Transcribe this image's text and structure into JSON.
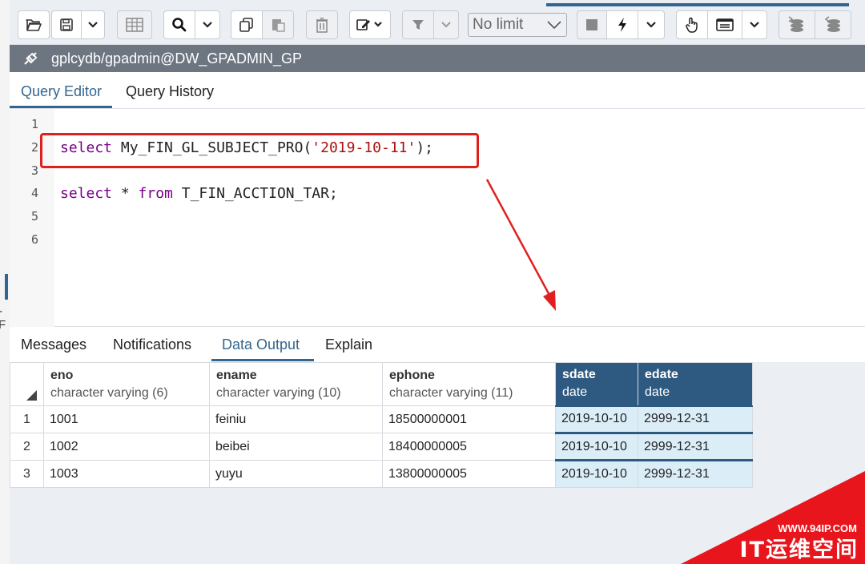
{
  "toolbar": {
    "limit_select": "No limit",
    "buttons": [
      {
        "icon": "open-folder-icon"
      },
      {
        "icon": "save-icon"
      },
      {
        "icon": "chevron-down-icon"
      },
      {
        "icon": "edit-grid-icon"
      },
      {
        "icon": "search-icon"
      },
      {
        "icon": "chevron-down-icon"
      },
      {
        "icon": "copy-icon"
      },
      {
        "icon": "paste-icon"
      },
      {
        "icon": "delete-icon"
      },
      {
        "icon": "edit-icon"
      },
      {
        "icon": "filter-icon"
      },
      {
        "icon": "stop-icon"
      },
      {
        "icon": "execute-lightning-icon"
      },
      {
        "icon": "explain-hand-icon"
      },
      {
        "icon": "macro-icon"
      },
      {
        "icon": "commit-icon"
      },
      {
        "icon": "rollback-icon"
      }
    ]
  },
  "connection": {
    "icon": "connection-plug-icon",
    "label": "gplcydb/gpadmin@DW_GPADMIN_GP"
  },
  "editor_tabs": [
    {
      "label": "Query Editor",
      "active": true
    },
    {
      "label": "Query History",
      "active": false
    }
  ],
  "editor": {
    "line_numbers": [
      "1",
      "2",
      "3",
      "4",
      "5",
      "6"
    ],
    "line2": {
      "kw": "select",
      "fn": "My_FIN_GL_SUBJECT_PRO(",
      "str": "'2019-10-11'",
      "end": ");"
    },
    "line4": {
      "kw1": "select",
      "mid": " * ",
      "kw2": "from",
      "rest": " T_FIN_ACCTION_TAR;"
    }
  },
  "output_tabs": [
    {
      "label": "Messages",
      "active": false
    },
    {
      "label": "Notifications",
      "active": false
    },
    {
      "label": "Data Output",
      "active": true
    },
    {
      "label": "Explain",
      "active": false
    }
  ],
  "grid": {
    "columns": [
      {
        "name": "eno",
        "type": "character varying (6)",
        "selected": false
      },
      {
        "name": "ename",
        "type": "character varying (10)",
        "selected": false
      },
      {
        "name": "ephone",
        "type": "character varying (11)",
        "selected": false
      },
      {
        "name": "sdate",
        "type": "date",
        "selected": true
      },
      {
        "name": "edate",
        "type": "date",
        "selected": true
      }
    ],
    "rows": [
      {
        "n": "1",
        "cells": [
          "1001",
          "feiniu",
          "18500000001",
          "2019-10-10",
          "2999-12-31"
        ]
      },
      {
        "n": "2",
        "cells": [
          "1002",
          "beibei",
          "18400000005",
          "2019-10-10",
          "2999-12-31"
        ]
      },
      {
        "n": "3",
        "cells": [
          "1003",
          "yuyu",
          "13800000005",
          "2019-10-10",
          "2999-12-31"
        ]
      }
    ]
  },
  "watermark": {
    "url": "WWW.94IP.COM",
    "name": "IT运维空间"
  },
  "left_fragment": "-F",
  "colors": {
    "accent": "#326690",
    "annotation": "#e02020",
    "connbar": "#6d7581"
  }
}
